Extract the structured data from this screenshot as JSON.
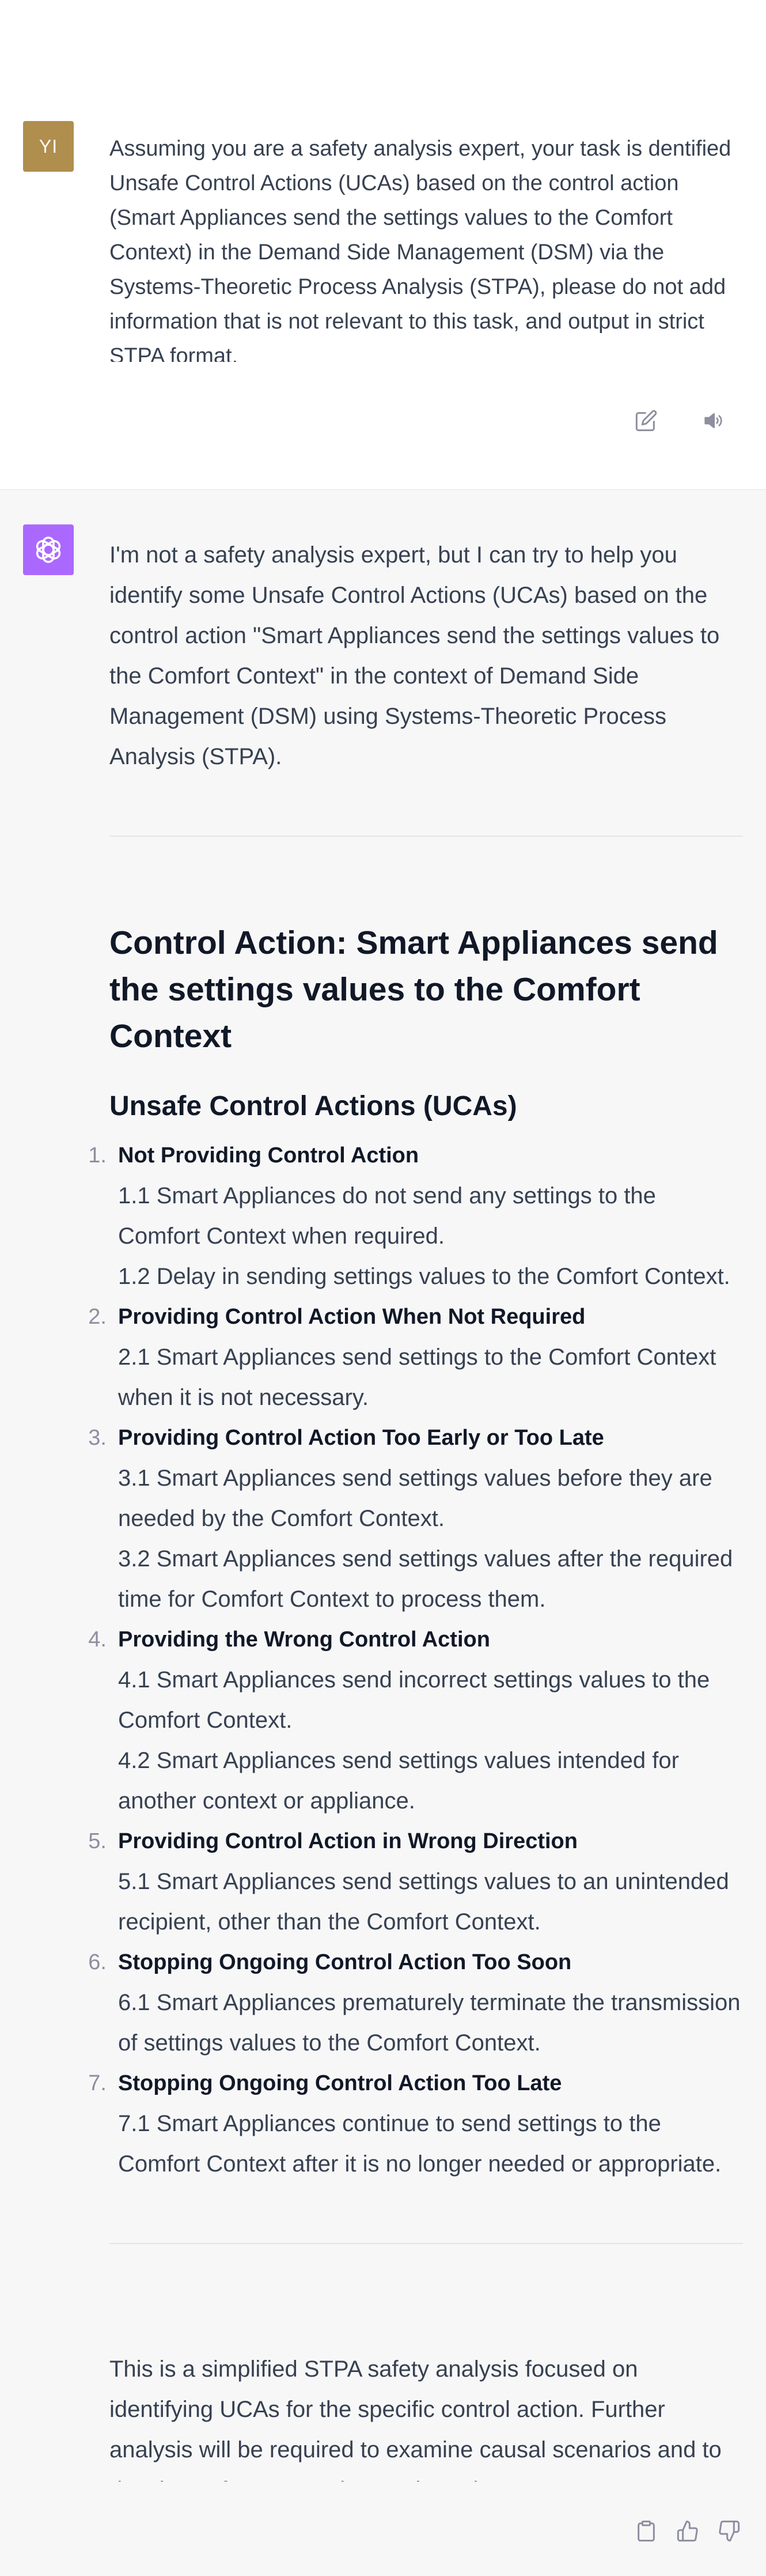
{
  "user": {
    "avatar_initials": "YI",
    "avatar_color": "#b08e4e",
    "message": "Assuming you are a safety analysis expert, your task is dentified Unsafe Control Actions (UCAs) based on the control action (Smart Appliances send the settings values to the Comfort Context) in the Demand Side Management (DSM) via the Systems-Theoretic Process Analysis (STPA), please do not add information that is not relevant to this task, and output in strict STPA format.",
    "actions": [
      "edit-icon",
      "speaker-icon"
    ]
  },
  "assistant": {
    "avatar_color": "#ab68ff",
    "intro": "I'm not a safety analysis expert, but I can try to help you identify some Unsafe Control Actions (UCAs) based on the control action \"Smart Appliances send the settings values to the Comfort Context\" in the context of Demand Side Management (DSM) using Systems-Theoretic Process Analysis (STPA).",
    "heading": "Control Action: Smart Appliances send the settings values to the Comfort Context",
    "subheading": "Unsafe Control Actions (UCAs)",
    "ucas": [
      {
        "num": "1.",
        "title": "Not Providing Control Action",
        "subs": [
          "1.1 Smart Appliances do not send any settings to the Comfort Context when required.",
          "1.2 Delay in sending settings values to the Comfort Context."
        ]
      },
      {
        "num": "2.",
        "title": "Providing Control Action When Not Required",
        "subs": [
          "2.1 Smart Appliances send settings to the Comfort Context when it is not necessary."
        ]
      },
      {
        "num": "3.",
        "title": "Providing Control Action Too Early or Too Late",
        "subs": [
          "3.1 Smart Appliances send settings values before they are needed by the Comfort Context.",
          "3.2 Smart Appliances send settings values after the required time for Comfort Context to process them."
        ]
      },
      {
        "num": "4.",
        "title": "Providing the Wrong Control Action",
        "subs": [
          "4.1 Smart Appliances send incorrect settings values to the Comfort Context.",
          "4.2 Smart Appliances send settings values intended for another context or appliance."
        ]
      },
      {
        "num": "5.",
        "title": "Providing Control Action in Wrong Direction",
        "subs": [
          "5.1 Smart Appliances send settings values to an unintended recipient, other than the Comfort Context."
        ]
      },
      {
        "num": "6.",
        "title": "Stopping Ongoing Control Action Too Soon",
        "subs": [
          "6.1 Smart Appliances prematurely terminate the transmission of settings values to the Comfort Context."
        ]
      },
      {
        "num": "7.",
        "title": "Stopping Ongoing Control Action Too Late",
        "subs": [
          "7.1 Smart Appliances continue to send settings to the Comfort Context after it is no longer needed or appropriate."
        ]
      }
    ],
    "outro": "This is a simplified STPA safety analysis focused on identifying UCAs for the specific control action. Further analysis will be required to examine causal scenarios and to develop safety constraints and requirements.",
    "actions": [
      "clipboard-icon",
      "thumbs-up-icon",
      "thumbs-down-icon"
    ]
  }
}
